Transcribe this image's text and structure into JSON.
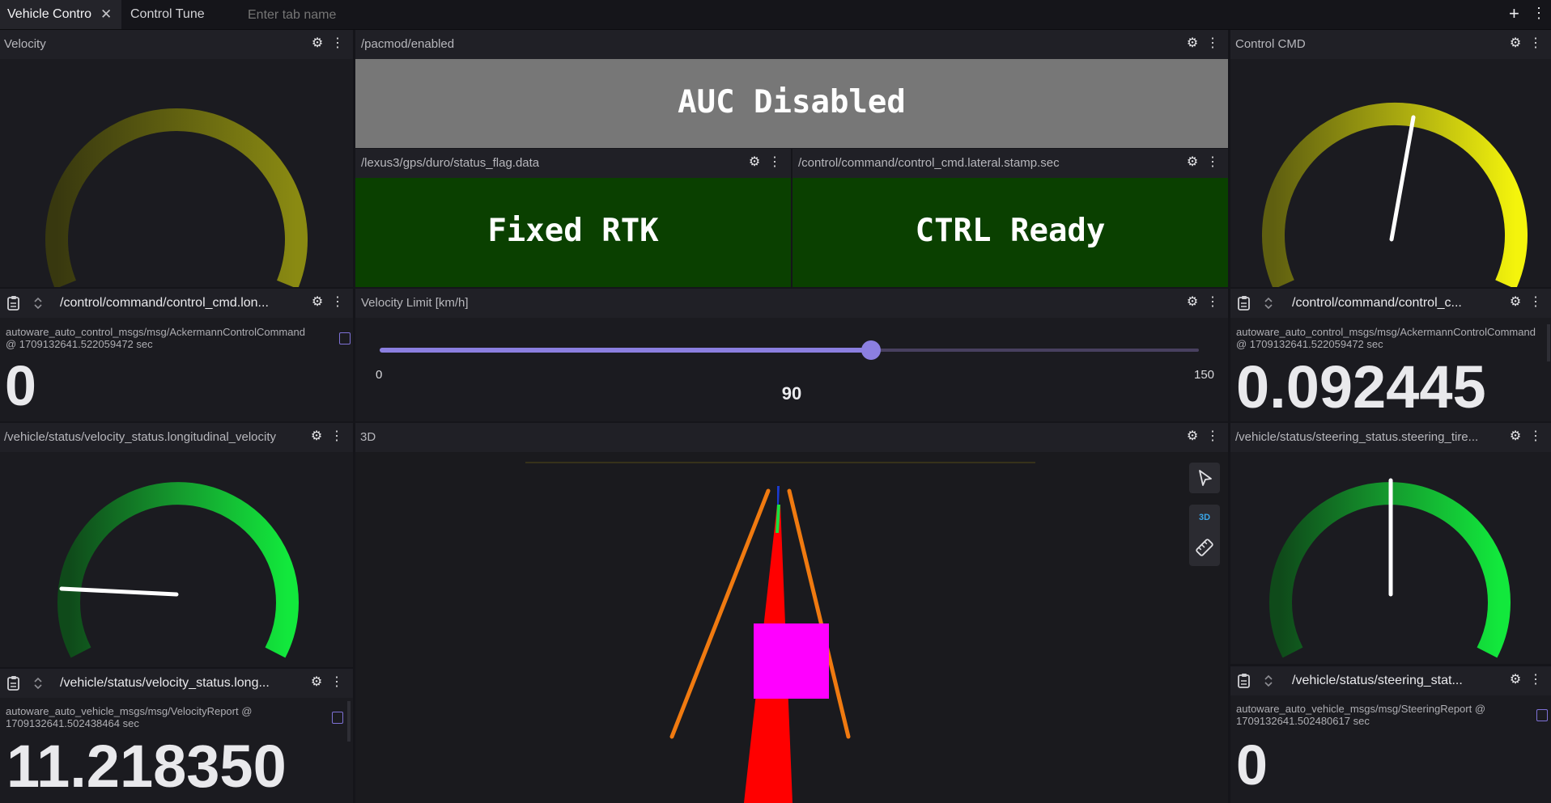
{
  "tabs": [
    {
      "label": "Vehicle Contro",
      "active": true
    },
    {
      "label": "Control Tune",
      "active": false
    }
  ],
  "tab_input_placeholder": "Enter tab name",
  "add_tab_symbol": "+",
  "menu_symbol": "⋮",
  "gear_symbol": "⚙",
  "panels": {
    "velocity_gauge": {
      "title": "Velocity",
      "level": 0
    },
    "pacmod": {
      "title": "/pacmod/enabled",
      "text": "AUC Disabled",
      "color": "#777777"
    },
    "gps": {
      "title": "/lexus3/gps/duro/status_flag.data",
      "text": "Fixed RTK",
      "color": "#0a4000"
    },
    "ctrl_ready": {
      "title": "/control/command/control_cmd.lateral.stamp.sec",
      "text": "CTRL Ready",
      "color": "#0a4000"
    },
    "control_cmd_gauge": {
      "title": "Control CMD",
      "level": 0.56
    },
    "control_cmd_long": {
      "title": "/control/command/control_cmd.lon...",
      "msg_type": "autoware_auto_control_msgs/msg/AckermannControlCommand",
      "stamp": "@ 1709132641.522059472 sec",
      "value": "0"
    },
    "velocity_limit": {
      "title": "Velocity Limit [km/h]",
      "min": "0",
      "max": "150",
      "value": "90",
      "fraction": 0.6,
      "accent": "#8b7fe0"
    },
    "control_cmd_lat": {
      "title": "/control/command/control_c...",
      "msg_type": "autoware_auto_control_msgs/msg/AckermannControlCommand",
      "stamp": "@ 1709132641.522059472 sec",
      "value": "0.092445"
    },
    "long_velocity_gauge": {
      "title": "/vehicle/status/velocity_status.longitudinal_velocity",
      "level": 0.04
    },
    "view3d": {
      "title": "3D",
      "mode_label": "3D"
    },
    "steering_gauge": {
      "title": "/vehicle/status/steering_status.steering_tire...",
      "level": 0.5
    },
    "velocity_report": {
      "title": "/vehicle/status/velocity_status.long...",
      "msg_type": "autoware_auto_vehicle_msgs/msg/VelocityReport @",
      "stamp": "1709132641.502438464 sec",
      "value": "11.218350"
    },
    "steering_report": {
      "title": "/vehicle/status/steering_stat...",
      "msg_type": "autoware_auto_vehicle_msgs/msg/SteeringReport @",
      "stamp": "1709132641.502480617 sec",
      "value": "0"
    }
  }
}
